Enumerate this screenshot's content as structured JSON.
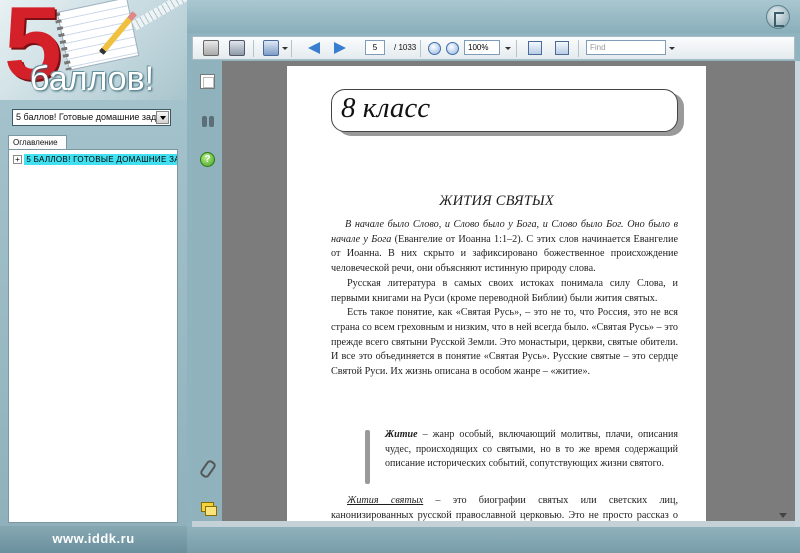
{
  "app": {
    "logo_number": "5",
    "logo_word": "баллов!",
    "site_url": "www.iddk.ru"
  },
  "sidebar": {
    "book_select_value": "5 баллов! Готовые домашние зад",
    "toc_tab_label": "Оглавление",
    "toc_items": [
      {
        "expander": "+",
        "label": "5 БАЛЛОВ! ГОТОВЫЕ ДОМАШНИЕ ЗА"
      }
    ]
  },
  "toolbar": {
    "current_page": "5",
    "total_pages": "/ 1033",
    "zoom": "100%",
    "find_placeholder": "Find"
  },
  "document": {
    "grade": "8 класс",
    "chapter_title": "ЖИТИЯ СВЯТЫХ",
    "epigraph_italic": "В начале было Слово, и Слово было у Бога, и Слово было Бог. Оно было в начале у Бога",
    "epigraph_rest": " (Евангелие от Иоанна 1:1–2). С этих слов начинается Евангелие от Иоанна. В них скрыто и зафиксировано божественное происхождение человеческой речи, они объясняют истинную природу слова.",
    "paragraph_2": "Русская литература в самых своих истоках понимала силу Слова, и первыми книгами на Руси (кроме переводной Библии) были жития святых.",
    "paragraph_3": "Есть такое понятие, как «Святая Русь», – это не то, что Россия, это не вся страна со всем греховным и низким, что в ней всегда было. «Святая Русь» – это прежде всего святыни Русской Земли. Это монастыри, церкви, святые обители. И все это объединяется в понятие «Святая Русь». Русские святые – это сердце Святой Руси. Их жизнь описана в особом жанре – «житие».",
    "callout_term": "Житие",
    "callout_text": " – жанр особый, включающий молитвы, плачи, описания чудес, происходящих со святыми, но в то же время содержащий описание исторических событий, сопутствующих жизни святого.",
    "final_term": "Жития святых",
    "final_text": " – это биографии святых или светских лиц, канонизированных русской православной церковью. Это не просто рассказ о жизни святых, а и поучение читателю о пользе добродетели."
  }
}
